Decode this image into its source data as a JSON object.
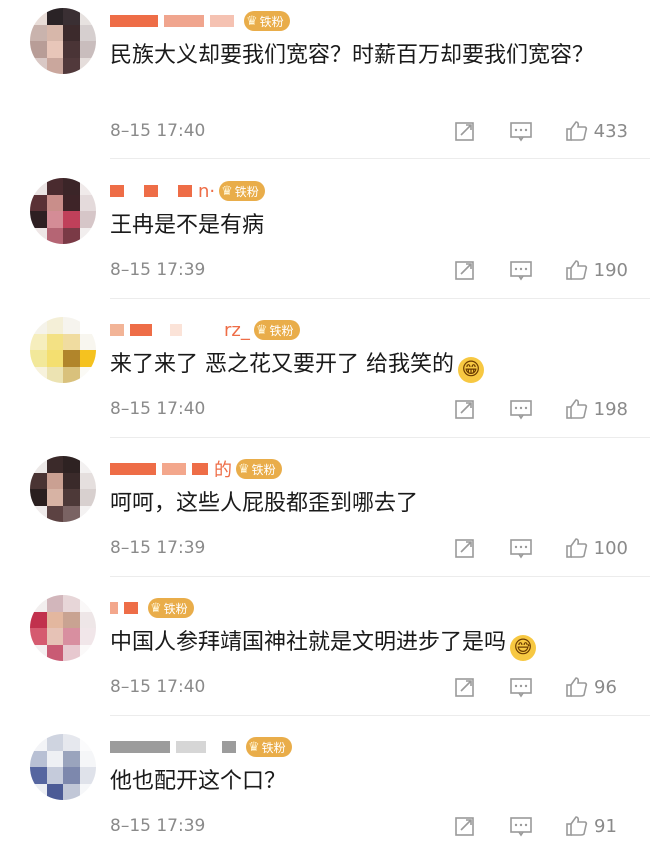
{
  "badge_label": "铁粉",
  "icons": {
    "repost": "repost-icon",
    "comment": "comment-icon",
    "like": "thumbs-up-icon",
    "badge": "crown-icon"
  },
  "colors": {
    "badge": "#e9ad4a",
    "time": "#8a8a8a",
    "text": "#1a1a1a"
  },
  "comments": [
    {
      "name_visible": "",
      "text": "民族大义却要我们宽容？时薪百万却要我们宽容？",
      "emoji": "",
      "time": "8–15 17:40",
      "likes": "433"
    },
    {
      "name_visible": "n·",
      "text": "王冉是不是有病",
      "emoji": "",
      "time": "8–15 17:39",
      "likes": "190"
    },
    {
      "name_visible": "rz_",
      "text": "来了来了 恶之花又要开了 给我笑的",
      "emoji": "😁",
      "time": "8–15 17:40",
      "likes": "198"
    },
    {
      "name_visible": "的",
      "text": "呵呵，这些人屁股都歪到哪去了",
      "emoji": "",
      "time": "8–15 17:39",
      "likes": "100"
    },
    {
      "name_visible": "",
      "text": "中国人参拜靖国神社就是文明进步了是吗",
      "emoji": "😅",
      "time": "8–15 17:40",
      "likes": "96"
    },
    {
      "name_visible": "",
      "text": "他也配开这个口？",
      "emoji": "",
      "time": "8–15 17:39",
      "likes": "91"
    }
  ]
}
